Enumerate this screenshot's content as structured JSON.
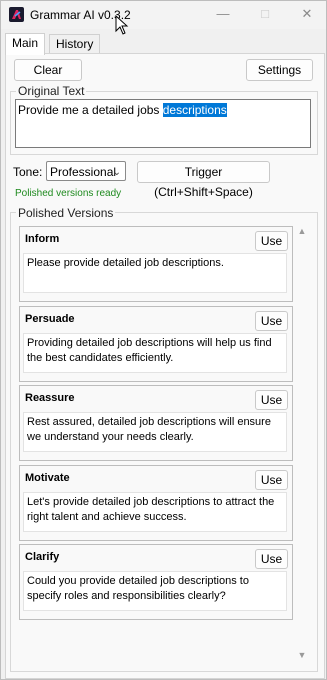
{
  "window": {
    "title": "Grammar AI v0.3.2"
  },
  "tabs": [
    {
      "label": "Main"
    },
    {
      "label": "History"
    }
  ],
  "toolbar": {
    "clear_label": "Clear",
    "settings_label": "Settings"
  },
  "original_text": {
    "group_label": "Original Text",
    "value_plain": "Provide me a detailed jobs ",
    "value_selected": "descriptions"
  },
  "tone": {
    "label": "Tone:",
    "selected": "Professional",
    "trigger_label": "Trigger (Ctrl+Shift+Space)"
  },
  "status": {
    "text": "Polished versions ready",
    "color": "#1e8a1e"
  },
  "polished": {
    "group_label": "Polished Versions",
    "use_label": "Use",
    "items": [
      {
        "title": "Inform",
        "text": "Please provide detailed job descriptions."
      },
      {
        "title": "Persuade",
        "text": "Providing detailed job descriptions will help us find the best candidates efficiently."
      },
      {
        "title": "Reassure",
        "text": "Rest assured, detailed job descriptions will ensure we understand your needs clearly."
      },
      {
        "title": "Motivate",
        "text": "Let's provide detailed job descriptions to attract the right talent and achieve success."
      },
      {
        "title": "Clarify",
        "text": "Could you provide detailed job descriptions to specify roles and responsibilities clearly?"
      }
    ]
  },
  "icons": {
    "app": "app-logo-icon",
    "minimize": "minimize-icon",
    "maximize": "maximize-icon",
    "close": "close-icon",
    "dropdown": "chevron-down-icon",
    "scroll_up": "scroll-up-icon",
    "scroll_down": "scroll-down-icon"
  },
  "colors": {
    "selection": "#0078d7",
    "status_green": "#1e8a1e"
  }
}
